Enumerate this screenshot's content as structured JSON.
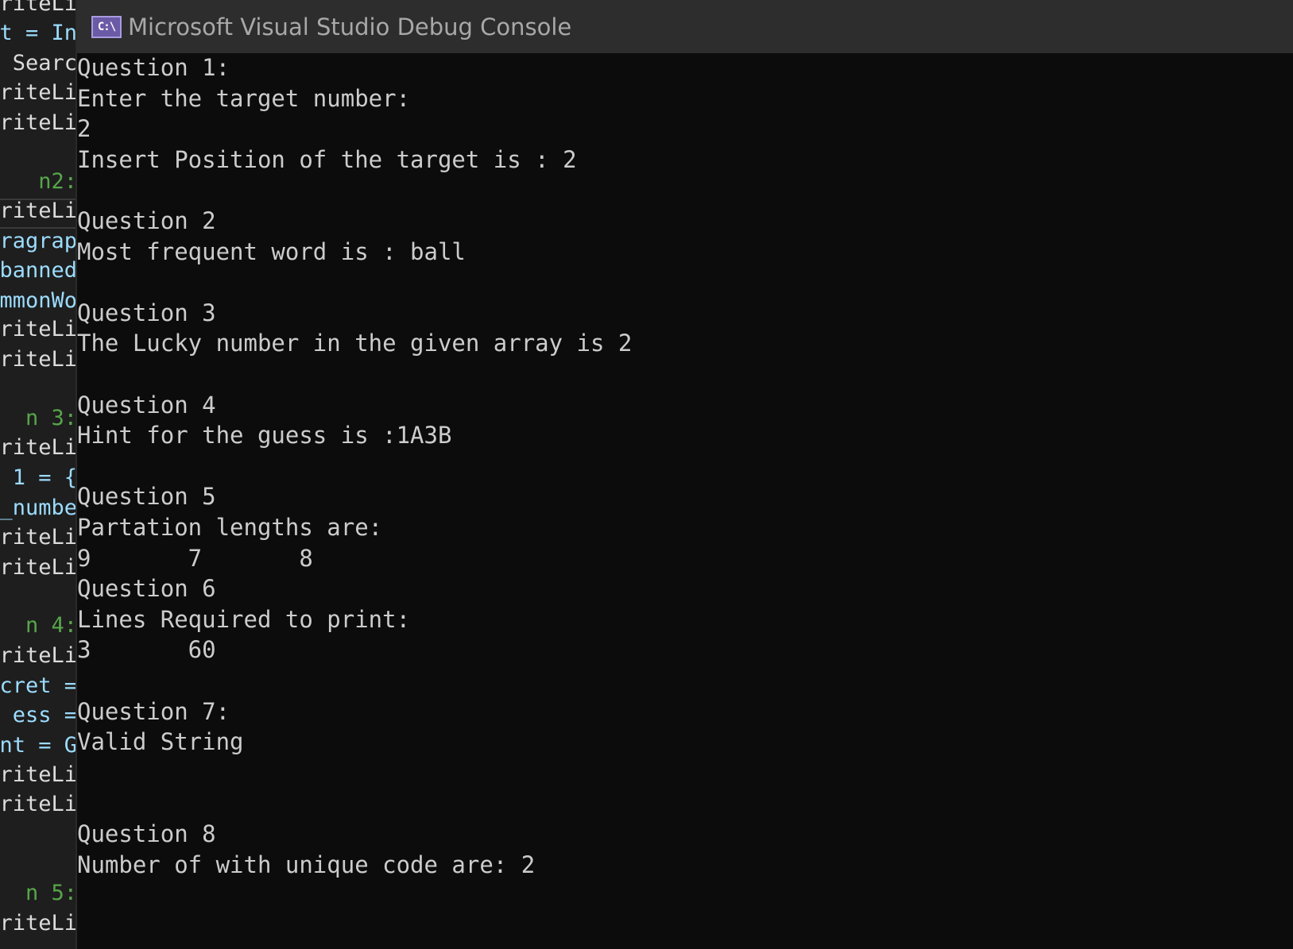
{
  "window": {
    "title": "Microsoft Visual Studio Debug Console",
    "icon": "console-app-icon",
    "icon_text": "C:\\"
  },
  "editor_fragments": [
    {
      "text": "riteLi",
      "color": "white"
    },
    {
      "text": "t = In",
      "color": "mixed"
    },
    {
      "text": " Searc",
      "color": "white"
    },
    {
      "text": "riteLi",
      "color": "white"
    },
    {
      "text": "riteLi",
      "color": "white"
    },
    {
      "text": "n2:",
      "color": "green"
    },
    {
      "text": "riteLi",
      "color": "white"
    },
    {
      "text": "ragrap",
      "color": "blue"
    },
    {
      "text": "banned",
      "color": "blue"
    },
    {
      "text": "mmonWo",
      "color": "blue"
    },
    {
      "text": "riteLi",
      "color": "white"
    },
    {
      "text": "riteLi",
      "color": "white"
    },
    {
      "text": "n 3:",
      "color": "green"
    },
    {
      "text": "riteLi",
      "color": "white"
    },
    {
      "text": "1 = {",
      "color": "blue"
    },
    {
      "text": "_numbe",
      "color": "blue"
    },
    {
      "text": "riteLi",
      "color": "white"
    },
    {
      "text": "riteLi",
      "color": "white"
    },
    {
      "text": "n 4:",
      "color": "green"
    },
    {
      "text": "riteLi",
      "color": "white"
    },
    {
      "text": "cret =",
      "color": "blue"
    },
    {
      "text": "ess =",
      "color": "blue"
    },
    {
      "text": "nt = G",
      "color": "blue"
    },
    {
      "text": "riteLi",
      "color": "white"
    },
    {
      "text": "riteLi",
      "color": "white"
    },
    {
      "text": "n 5:",
      "color": "green"
    },
    {
      "text": "riteLi",
      "color": "white"
    }
  ],
  "console_lines": [
    "Question 1:",
    "Enter the target number:",
    "2",
    "Insert Position of the target is : 2",
    "",
    "Question 2",
    "Most frequent word is : ball",
    "",
    "Question 3",
    "The Lucky number in the given array is 2",
    "",
    "Question 4",
    "Hint for the guess is :1A3B",
    "",
    "Question 5",
    "Partation lengths are:",
    "9       7       8",
    "Question 6",
    "Lines Required to print:",
    "3       60",
    "",
    "Question 7:",
    "Valid String",
    "",
    "",
    "Question 8",
    "Number of with unique code are: 2"
  ],
  "colors": {
    "console_bg": "#0c0c0c",
    "titlebar_bg": "#2d2d2d",
    "console_text": "#cccccc",
    "editor_green": "#57a64a",
    "editor_blue": "#9cdcfe"
  }
}
